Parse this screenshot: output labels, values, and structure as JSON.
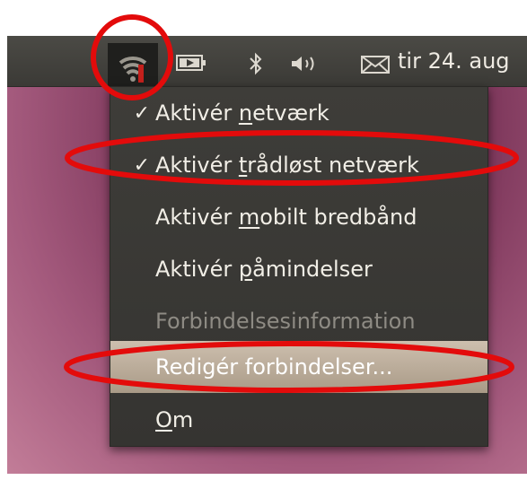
{
  "panel": {
    "clock": "tir 24. aug",
    "icons": [
      "wifi-icon",
      "battery-icon",
      "bluetooth-icon",
      "volume-icon",
      "mail-icon"
    ]
  },
  "menu": {
    "items": [
      {
        "check": "✓",
        "pre": "Aktivér ",
        "key": "n",
        "post": "etværk",
        "state": "checked"
      },
      {
        "check": "✓",
        "pre": "Aktivér ",
        "key": "t",
        "post": "rådløst netværk",
        "state": "checked"
      },
      {
        "check": "",
        "pre": "Aktivér ",
        "key": "m",
        "post": "obilt bredbånd",
        "state": "normal"
      },
      {
        "check": "",
        "pre": "Aktivér ",
        "key": "p",
        "post": "åmindelser",
        "state": "normal"
      },
      {
        "check": "",
        "pre": "Forbindelsesinformation",
        "key": "",
        "post": "",
        "state": "disabled"
      },
      {
        "check": "",
        "pre": "Redigér forbindelser...",
        "key": "",
        "post": "",
        "state": "selected"
      },
      {
        "check": "",
        "pre": "",
        "key": "O",
        "post": "m",
        "state": "normal"
      }
    ]
  },
  "colors": {
    "annotation": "#e30b0b",
    "selected_bg": "#bba995",
    "menu_bg": "#3a3935",
    "desktop": "#8a3f67"
  }
}
